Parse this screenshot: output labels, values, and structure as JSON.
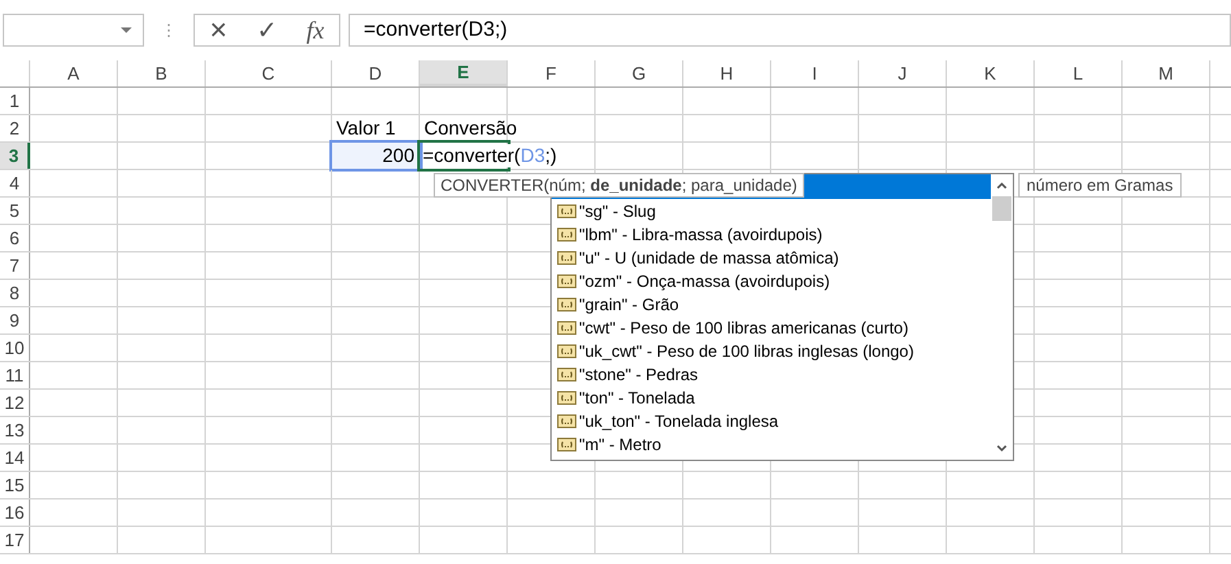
{
  "formula_bar": {
    "grip": "⋮",
    "cancel": "×",
    "enter": "✓",
    "function": "fx",
    "formula": "=converter(D3;)"
  },
  "columns": [
    {
      "label": "A",
      "selected": false
    },
    {
      "label": "B",
      "selected": false
    },
    {
      "label": "C",
      "selected": false
    },
    {
      "label": "D",
      "selected": false
    },
    {
      "label": "E",
      "selected": true
    },
    {
      "label": "F",
      "selected": false
    },
    {
      "label": "G",
      "selected": false
    },
    {
      "label": "H",
      "selected": false
    },
    {
      "label": "I",
      "selected": false
    },
    {
      "label": "J",
      "selected": false
    },
    {
      "label": "K",
      "selected": false
    },
    {
      "label": "L",
      "selected": false
    },
    {
      "label": "M",
      "selected": false
    }
  ],
  "rows": [
    {
      "label": "1",
      "selected": false,
      "cells": []
    },
    {
      "label": "2",
      "selected": false,
      "cells": [
        null,
        null,
        null,
        {
          "kind": "text",
          "text": "Valor 1"
        },
        {
          "kind": "text",
          "text": "Conversão"
        }
      ]
    },
    {
      "label": "3",
      "selected": true,
      "cells": [
        null,
        null,
        null,
        {
          "kind": "number",
          "text": "200",
          "referenced": true
        },
        {
          "kind": "formula",
          "active": true,
          "parts": [
            {
              "kind": "plain",
              "text": "=converter("
            },
            {
              "kind": "reference",
              "text": "D3"
            },
            {
              "kind": "plain",
              "text": ";)"
            }
          ]
        }
      ]
    },
    {
      "label": "4",
      "selected": false,
      "cells": []
    },
    {
      "label": "5",
      "selected": false,
      "cells": []
    },
    {
      "label": "6",
      "selected": false,
      "cells": []
    },
    {
      "label": "7",
      "selected": false,
      "cells": []
    },
    {
      "label": "8",
      "selected": false,
      "cells": []
    },
    {
      "label": "9",
      "selected": false,
      "cells": []
    },
    {
      "label": "10",
      "selected": false,
      "cells": []
    },
    {
      "label": "11",
      "selected": false,
      "cells": []
    },
    {
      "label": "12",
      "selected": false,
      "cells": []
    },
    {
      "label": "13",
      "selected": false,
      "cells": []
    },
    {
      "label": "14",
      "selected": false,
      "cells": []
    },
    {
      "label": "15",
      "selected": false,
      "cells": []
    },
    {
      "label": "16",
      "selected": false,
      "cells": []
    },
    {
      "label": "17",
      "selected": false,
      "cells": []
    }
  ],
  "function_tooltip": "CONVERTER(núm; **de_unidade**; para_unidade)",
  "autocomplete": {
    "highlighted_row": true,
    "description": "número em Gramas",
    "items": [
      {
        "label": "\"sg\" - Slug"
      },
      {
        "label": "\"lbm\" - Libra-massa (avoirdupois)"
      },
      {
        "label": "\"u\" - U (unidade de massa atômica)"
      },
      {
        "label": "\"ozm\" - Onça-massa (avoirdupois)"
      },
      {
        "label": "\"grain\" - Grão"
      },
      {
        "label": "\"cwt\" - Peso de 100 libras americanas (curto)"
      },
      {
        "label": "\"uk_cwt\" - Peso de 100 libras inglesas (longo)"
      },
      {
        "label": "\"stone\" - Pedras"
      },
      {
        "label": "\"ton\" - Tonelada"
      },
      {
        "label": "\"uk_ton\" - Tonelada inglesa"
      },
      {
        "label": "\"m\" - Metro"
      }
    ]
  }
}
